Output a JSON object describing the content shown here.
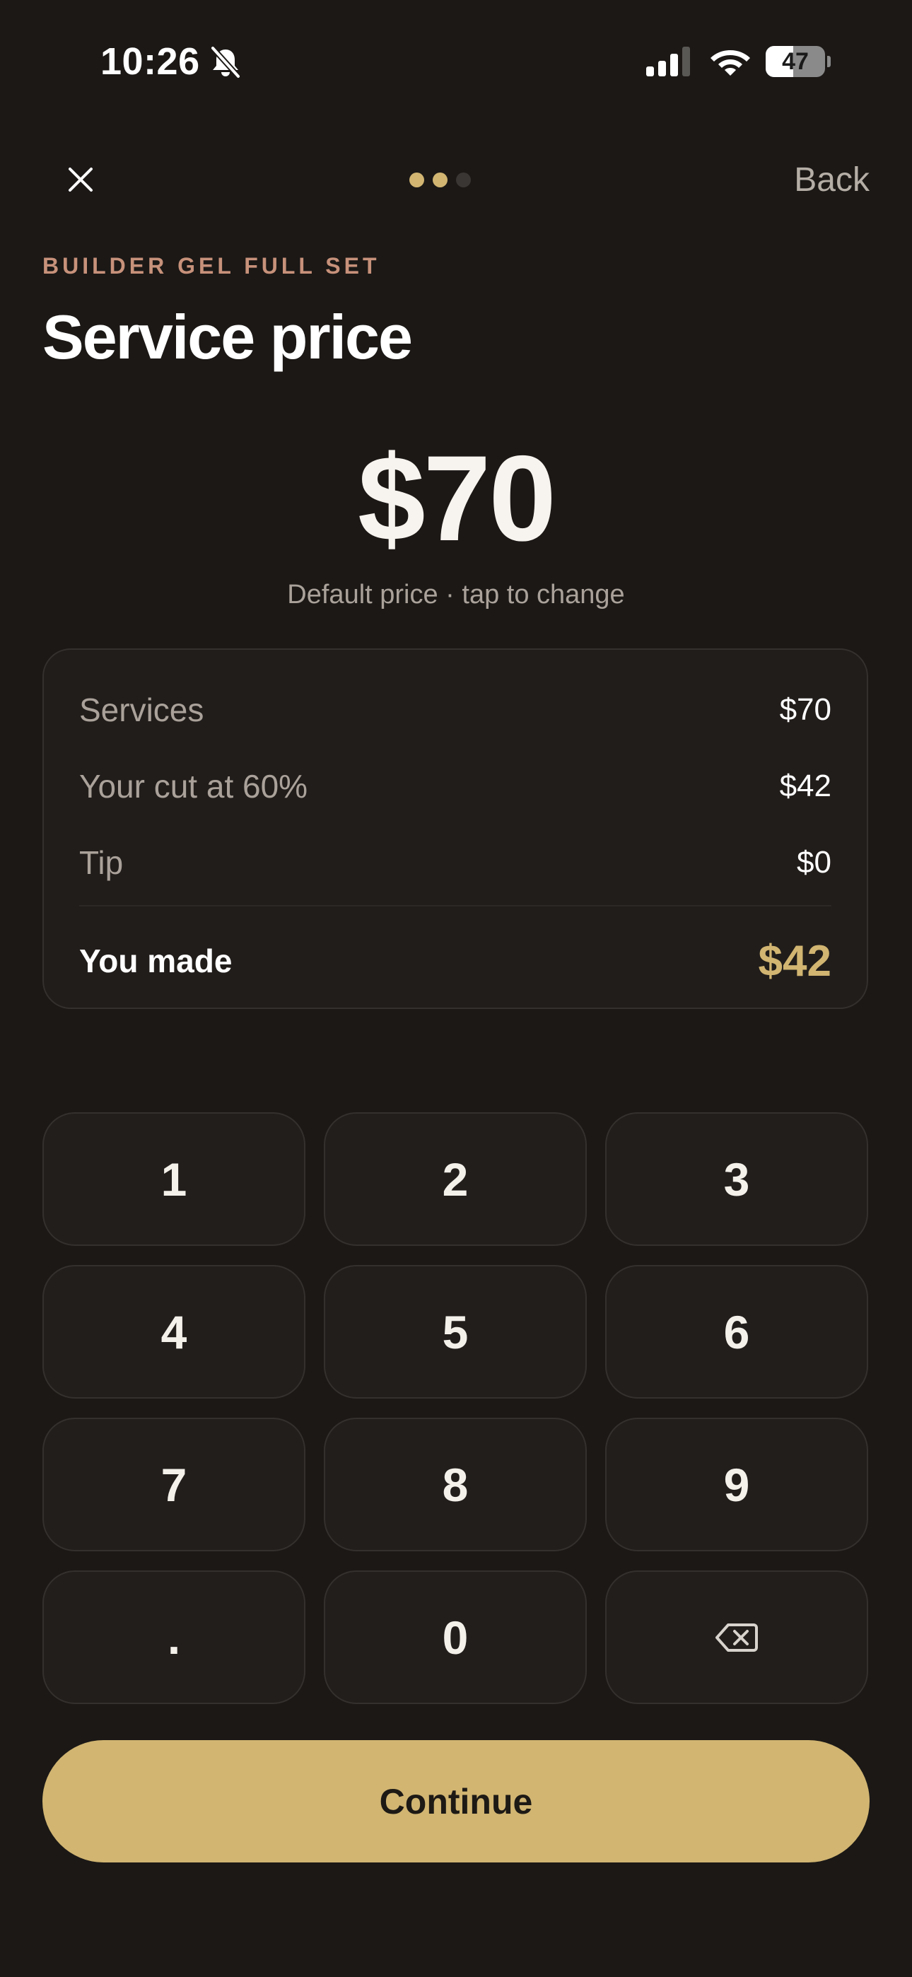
{
  "status_bar": {
    "time": "10:26",
    "battery": "47",
    "battery_level": 0.47,
    "icons": [
      "bell-slash-icon",
      "cellular-signal-icon",
      "wifi-icon",
      "battery-icon"
    ]
  },
  "nav": {
    "close_icon": "close-icon",
    "back_label": "Back",
    "steps_total": 3,
    "current_step": 2
  },
  "header": {
    "eyebrow": "BUILDER GEL FULL SET",
    "title": "Service price"
  },
  "price": {
    "amount": "$70",
    "hint": "Default price · tap to change"
  },
  "summary": {
    "rows": [
      {
        "label": "Services",
        "value": "$70"
      },
      {
        "label": "Your cut at 60%",
        "value": "$42"
      },
      {
        "label": "Tip",
        "value": "$0"
      }
    ],
    "total_label": "You made",
    "total_value": "$42"
  },
  "keypad": {
    "keys": [
      "1",
      "2",
      "3",
      "4",
      "5",
      "6",
      "7",
      "8",
      "9",
      ".",
      "0"
    ],
    "backspace_icon": "backspace-icon"
  },
  "continue_label": "Continue",
  "colors": {
    "background": "#1b1816",
    "card": "#211d1b",
    "accent": "#d1b571",
    "eyebrow": "#c7917a",
    "muted": "#aaa29a"
  }
}
